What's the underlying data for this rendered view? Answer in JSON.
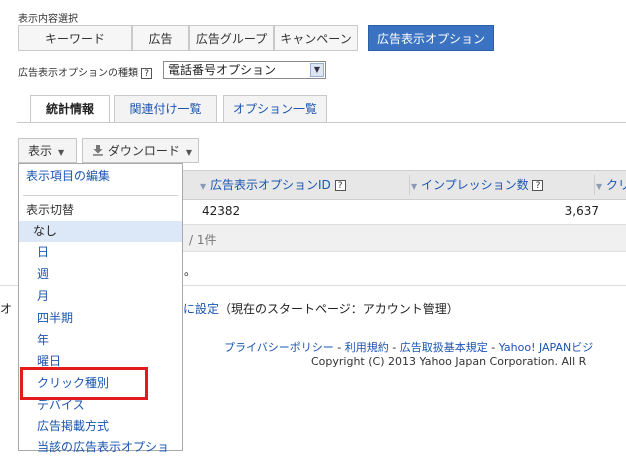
{
  "header": {
    "display_select_label": "表示内容選択",
    "tabs": [
      {
        "label": "キーワード",
        "active": false
      },
      {
        "label": "広告",
        "active": false
      },
      {
        "label": "広告グループ",
        "active": false
      },
      {
        "label": "キャンペーン",
        "active": false
      },
      {
        "label": "広告表示オプション",
        "active": true
      }
    ],
    "option_type_label": "広告表示オプションの種類",
    "option_type_value": "電話番号オプション"
  },
  "subtabs": [
    {
      "label": "統計情報",
      "active": true
    },
    {
      "label": "関連付け一覧",
      "active": false
    },
    {
      "label": "オプション一覧",
      "active": false
    }
  ],
  "toolbar": {
    "display_label": "表示",
    "download_label": "ダウンロード"
  },
  "table": {
    "columns": [
      "広告表示オプションID",
      "インプレッション数",
      "クリ"
    ],
    "row": {
      "id": "42382",
      "impressions": "3,637"
    },
    "footer_count": "1件",
    "after_text": "。"
  },
  "page_settings": {
    "left_fragment": "オ",
    "link_text": "に設定",
    "current_text": "（現在のスタートページ：アカウント管理）"
  },
  "footer": {
    "privacy": "プライバシーポリシー",
    "terms": "利用規約",
    "ad_terms": "広告取扱基本規定",
    "yahoo": "Yahoo! JAPANビジ",
    "sep": " - ",
    "copyright": "Copyright (C) 2013 Yahoo Japan Corporation. All R"
  },
  "menu": {
    "edit_items": "表示項目の編集",
    "section_label": "表示切替",
    "items": [
      "なし",
      "日",
      "週",
      "月",
      "四半期",
      "年",
      "曜日",
      "クリック種別",
      "デバイス",
      "広告掲載方式",
      "当該の広告表示オプショ"
    ]
  },
  "colors": {
    "accent": "#3b73c2",
    "link": "#1a55b0",
    "highlight": "#e31b1b"
  }
}
